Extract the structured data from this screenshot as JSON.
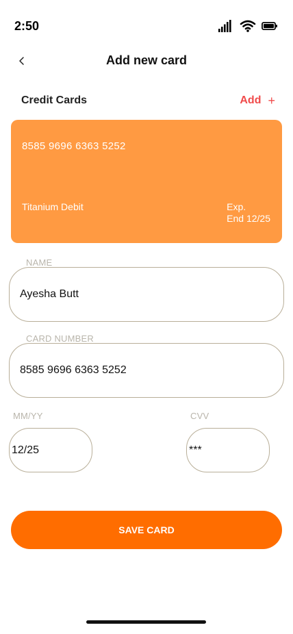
{
  "status_bar": {
    "time": "2:50",
    "icons": [
      "cellular-signal-icon",
      "wifi-icon",
      "battery-icon"
    ]
  },
  "nav": {
    "title": "Add new card",
    "back_icon": "chevron-left-icon"
  },
  "section": {
    "title": "Credit Cards",
    "add_label": "Add",
    "add_icon": "+",
    "add_color": "#f04b4b"
  },
  "card": {
    "number": "8585 9696 6363 5252",
    "type": "Titanium Debit",
    "exp_label": "Exp.",
    "exp_value": "End 12/25",
    "color": "#ff9a42"
  },
  "form": {
    "name_label": "NAME",
    "name_value": "Ayesha Butt",
    "card_number_label": "CARD NUMBER",
    "card_number_value": "8585 9696 6363 5252",
    "expiry_label": "MM/YY",
    "expiry_value": "12/25",
    "cvv_label": "CVV",
    "cvv_value": "***"
  },
  "actions": {
    "save_label": "SAVE CARD",
    "save_color": "#ff6d00"
  }
}
